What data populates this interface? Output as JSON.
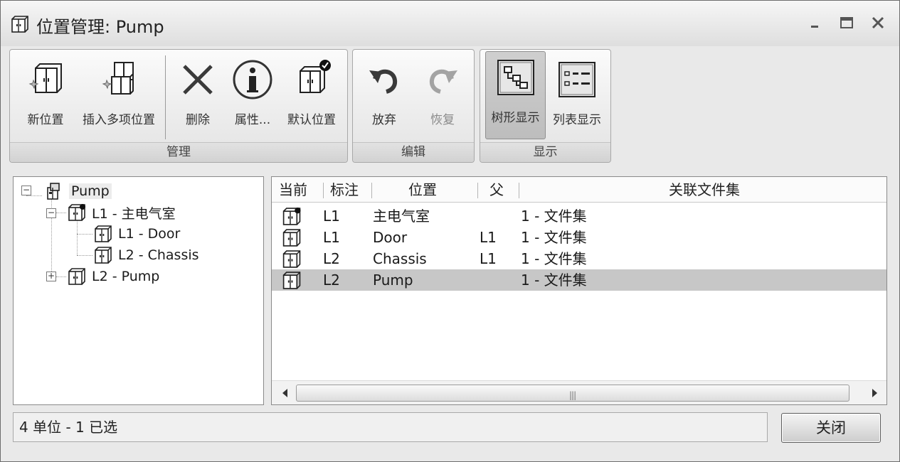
{
  "window": {
    "title": "位置管理: Pump"
  },
  "ribbon": {
    "groups": [
      {
        "label": "管理",
        "buttons": [
          {
            "label": "新位置",
            "icon": "new-location-icon"
          },
          {
            "label": "插入多项位置",
            "icon": "insert-multiple-locations-icon"
          },
          {
            "label": "删除",
            "icon": "delete-x-icon"
          },
          {
            "label": "属性...",
            "icon": "info-icon"
          },
          {
            "label": "默认位置",
            "icon": "default-location-icon"
          }
        ]
      },
      {
        "label": "编辑",
        "buttons": [
          {
            "label": "放弃",
            "icon": "undo-icon"
          },
          {
            "label": "恢复",
            "icon": "redo-icon",
            "disabled": true
          }
        ]
      },
      {
        "label": "显示",
        "buttons": [
          {
            "label": "树形显示",
            "icon": "tree-view-icon",
            "pressed": true
          },
          {
            "label": "列表显示",
            "icon": "list-view-icon"
          }
        ]
      }
    ]
  },
  "tree": {
    "root": "Pump",
    "nodes": [
      {
        "label": "L1 - 主电气室",
        "expanded": true
      },
      {
        "label": "L1 - Door"
      },
      {
        "label": "L2 - Chassis"
      },
      {
        "label": "L2 - Pump",
        "expanded": false
      }
    ]
  },
  "table": {
    "columns": [
      "当前",
      "标注",
      "位置",
      "父",
      "关联文件集"
    ],
    "rows": [
      {
        "mark": "L1",
        "location": "主电气室",
        "parent": "",
        "fileset": "1 - 文件集",
        "current": true
      },
      {
        "mark": "L1",
        "location": "Door",
        "parent": "L1",
        "fileset": "1 - 文件集"
      },
      {
        "mark": "L2",
        "location": "Chassis",
        "parent": "L1",
        "fileset": "1 - 文件集"
      },
      {
        "mark": "L2",
        "location": "Pump",
        "parent": "",
        "fileset": "1 - 文件集",
        "selected": true
      }
    ]
  },
  "status": {
    "text": "4 单位 - 1 已选"
  },
  "footer": {
    "close_label": "关闭"
  }
}
